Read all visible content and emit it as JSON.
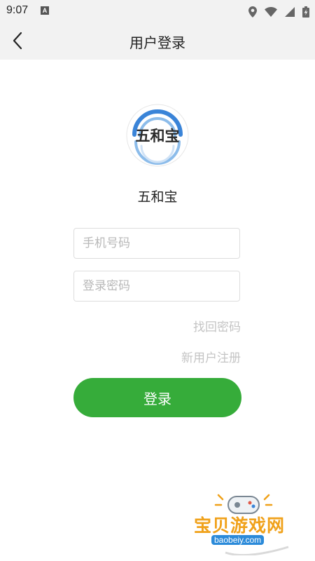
{
  "status_bar": {
    "time": "9:07",
    "notification_letter": "A"
  },
  "nav": {
    "title": "用户登录"
  },
  "logo": {
    "text": "五和宝"
  },
  "app_name": "五和宝",
  "form": {
    "phone_placeholder": "手机号码",
    "password_placeholder": "登录密码"
  },
  "links": {
    "forgot_password": "找回密码",
    "register": "新用户注册"
  },
  "login_button": "登录",
  "watermark": {
    "title": "宝贝游戏网",
    "url": "baobeiy.com"
  },
  "colors": {
    "primary_green": "#36ac3a",
    "link_gray": "#c4c4c4",
    "logo_blue": "#3a84d8",
    "watermark_orange": "#f0a11a"
  }
}
